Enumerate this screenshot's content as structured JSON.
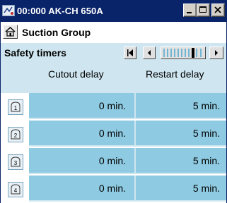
{
  "window": {
    "title": "00:000 AK-CH 650A",
    "controls": [
      "minimize",
      "maximize",
      "close"
    ]
  },
  "group": {
    "title": "Suction Group",
    "home_icon": "home-icon"
  },
  "section": {
    "title": "Safety timers"
  },
  "columns": {
    "cutout": "Cutout delay",
    "restart": "Restart delay"
  },
  "rows": [
    {
      "index": "1",
      "cutout": "0 min.",
      "restart": "5 min."
    },
    {
      "index": "2",
      "cutout": "0 min.",
      "restart": "5 min."
    },
    {
      "index": "3",
      "cutout": "0 min.",
      "restart": "5 min."
    },
    {
      "index": "4",
      "cutout": "0 min.",
      "restart": "5 min."
    }
  ],
  "colors": {
    "titlebar": "#0a246a",
    "header_bg": "#cfe6f0",
    "cell_bg": "#8ecae1"
  }
}
